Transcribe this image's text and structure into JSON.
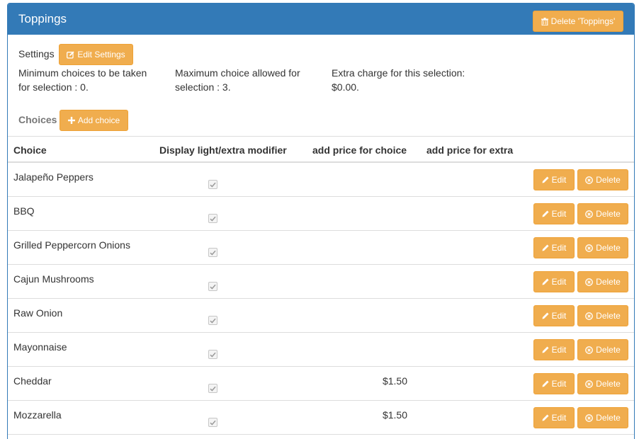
{
  "panel": {
    "title": "Toppings",
    "delete_label": "Delete 'Toppings'"
  },
  "settings": {
    "label": "Settings",
    "edit_label": "Edit Settings",
    "min_line1": "Minimum choices to be taken",
    "min_line2": "for selection : 0.",
    "max_line1": "Maximum choice allowed for",
    "max_line2": "selection : 3.",
    "extra_line1": "Extra charge for this selection:",
    "extra_line2": "$0.00."
  },
  "choices": {
    "label": "Choices",
    "add_label": "Add choice"
  },
  "table": {
    "headers": {
      "choice": "Choice",
      "display": "Display light/extra modifier",
      "price": "add price for choice",
      "extra": "add price for extra"
    },
    "edit_label": "Edit",
    "delete_label": "Delete",
    "rows": [
      {
        "name": "Jalapeño Peppers",
        "checked": true,
        "price": "",
        "extra": ""
      },
      {
        "name": "BBQ",
        "checked": true,
        "price": "",
        "extra": ""
      },
      {
        "name": "Grilled Peppercorn Onions",
        "checked": true,
        "price": "",
        "extra": ""
      },
      {
        "name": "Cajun Mushrooms",
        "checked": true,
        "price": "",
        "extra": ""
      },
      {
        "name": "Raw Onion",
        "checked": true,
        "price": "",
        "extra": ""
      },
      {
        "name": "Mayonnaise",
        "checked": true,
        "price": "",
        "extra": ""
      },
      {
        "name": "Cheddar",
        "checked": true,
        "price": "$1.50",
        "extra": ""
      },
      {
        "name": "Mozzarella",
        "checked": true,
        "price": "$1.50",
        "extra": ""
      }
    ]
  },
  "colors": {
    "primary": "#337ab7",
    "warning": "#f0ad4e",
    "border": "#dddddd",
    "muted": "#777777"
  },
  "icons": {
    "delete_group": "trash-icon",
    "edit_settings": "edit-square-icon",
    "add_choice": "plus-icon",
    "row_edit": "pencil-icon",
    "row_delete": "circle-x-icon"
  }
}
